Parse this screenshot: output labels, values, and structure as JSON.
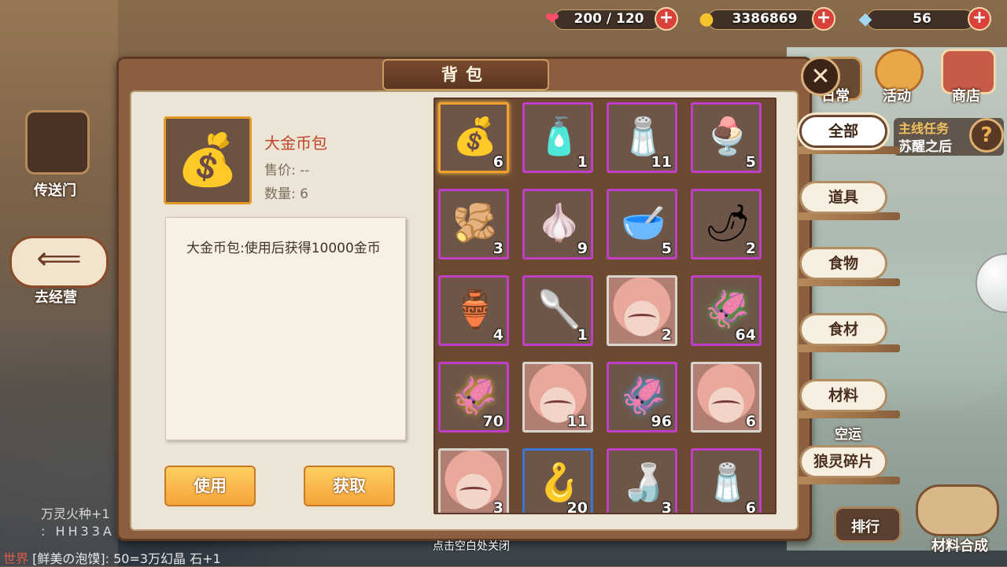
{
  "resources": [
    {
      "icon": "heart-icon",
      "value": "200 / 120",
      "glyph": "❤",
      "color": "#ff4d6a"
    },
    {
      "icon": "gold-coin-icon",
      "value": "3386869",
      "glyph": "●",
      "color": "#f5c42c"
    },
    {
      "icon": "crystal-icon",
      "value": "56",
      "glyph": "◆",
      "color": "#9fd8f0"
    }
  ],
  "top_nav": [
    {
      "label": "日常"
    },
    {
      "label": "活动"
    },
    {
      "label": "商店"
    }
  ],
  "left_nav": {
    "portal_label": "传送门",
    "go_business_label": "去经营"
  },
  "quest": {
    "type": "主线任务",
    "name": "苏醒之后",
    "help": "?"
  },
  "panel": {
    "title": "背包",
    "close": "✕",
    "selected": {
      "name": "大金币包",
      "price_label": "售价: --",
      "count_label": "数量: 6",
      "description": "大金币包:使用后获得10000金币"
    },
    "use_button": "使用",
    "obtain_button": "获取"
  },
  "grid": [
    {
      "name": "gold-bag",
      "count": "6",
      "glyph": "💰",
      "border": "sel"
    },
    {
      "name": "oil-bottle",
      "count": "1",
      "glyph": "🧴",
      "border": "purple"
    },
    {
      "name": "pepper-grinder",
      "count": "11",
      "glyph": "🧂",
      "border": "purple"
    },
    {
      "name": "cream-bowl",
      "count": "5",
      "glyph": "🍨",
      "border": "purple"
    },
    {
      "name": "ginger",
      "count": "3",
      "glyph": "🫚",
      "border": "purple"
    },
    {
      "name": "garlic",
      "count": "9",
      "glyph": "🧄",
      "border": "purple"
    },
    {
      "name": "scallion-bowl",
      "count": "5",
      "glyph": "🥣",
      "border": "purple"
    },
    {
      "name": "chili-plate",
      "count": "2",
      "glyph": "🌶",
      "border": "purple"
    },
    {
      "name": "sugar-bowl",
      "count": "4",
      "glyph": "🏺",
      "border": "purple"
    },
    {
      "name": "flour-bowl",
      "count": "1",
      "glyph": "🥄",
      "border": "purple"
    },
    {
      "name": "character-shard",
      "count": "2",
      "glyph": "portrait",
      "border": "white"
    },
    {
      "name": "green-lure",
      "count": "64",
      "glyph": "🦑",
      "border": "purple",
      "color": "#4ec24e"
    },
    {
      "name": "yellow-lure",
      "count": "70",
      "glyph": "🦑",
      "border": "purple",
      "color": "#e8b830"
    },
    {
      "name": "character-shard",
      "count": "11",
      "glyph": "portrait",
      "border": "white"
    },
    {
      "name": "blue-lure",
      "count": "96",
      "glyph": "🦑",
      "border": "purple",
      "color": "#3aa6e8"
    },
    {
      "name": "character-shard",
      "count": "6",
      "glyph": "portrait",
      "border": "white"
    },
    {
      "name": "character-shard",
      "count": "3",
      "glyph": "portrait",
      "border": "white"
    },
    {
      "name": "golden-lure",
      "count": "20",
      "glyph": "🪝",
      "border": "blue"
    },
    {
      "name": "cooking-wine",
      "count": "3",
      "glyph": "🍶",
      "border": "purple"
    },
    {
      "name": "salt-shaker",
      "count": "6",
      "glyph": "🧂",
      "border": "purple"
    }
  ],
  "tabs": [
    {
      "label": "全部",
      "active": true
    },
    {
      "label": "道具"
    },
    {
      "label": "食物"
    },
    {
      "label": "食材"
    },
    {
      "label": "材料"
    },
    {
      "label": "狼灵碎片"
    }
  ],
  "bottom": {
    "hint": "点击空白处关闭",
    "chat_line1": "万灵火种+1",
    "chat_line2": ": HH33A",
    "chat_channel": "世界",
    "chat_line3": "[鲜美の泡馍]: 50=3万幻晶 石+1",
    "luck_label": "空运",
    "rank_label": "排行",
    "craft_label": "材料合成"
  },
  "colors": {
    "accent": "#f3a12c",
    "rare_border": "#c13fc8",
    "name_red": "#c0452b"
  }
}
